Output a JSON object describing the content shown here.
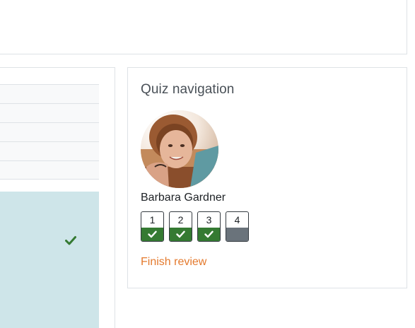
{
  "quiz_nav": {
    "title": "Quiz navigation",
    "user_name": "Barbara Gardner",
    "questions": [
      {
        "number": "1",
        "status": "correct"
      },
      {
        "number": "2",
        "status": "correct"
      },
      {
        "number": "3",
        "status": "correct"
      },
      {
        "number": "4",
        "status": "info"
      }
    ],
    "finish_label": "Finish review"
  },
  "icons": {
    "panel_status": "check-icon",
    "question_status": "check-icon"
  },
  "colors": {
    "correct": "#357a32",
    "info": "#6a737b",
    "link": "#e47a2e",
    "feedback_panel": "#cee5e9"
  }
}
